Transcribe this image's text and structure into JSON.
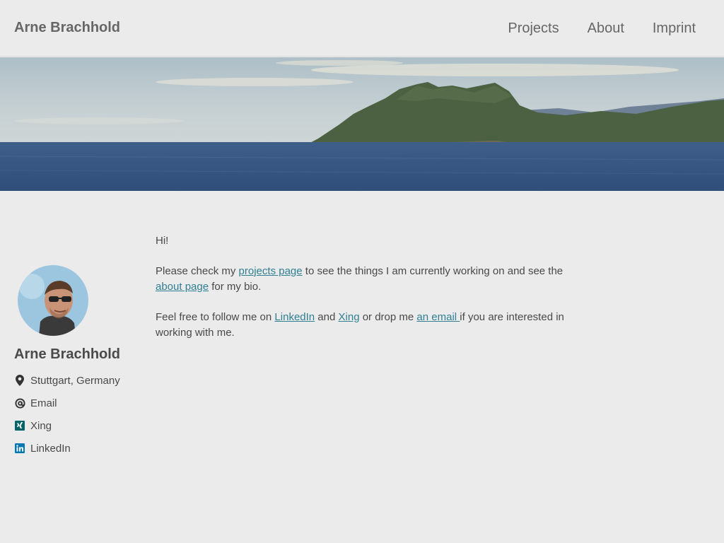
{
  "header": {
    "site_title": "Arne Brachhold",
    "nav": [
      {
        "label": "Projects"
      },
      {
        "label": "About"
      },
      {
        "label": "Imprint"
      }
    ]
  },
  "sidebar": {
    "name": "Arne Brachhold",
    "links": [
      {
        "icon": "map-marker-icon",
        "label": "Stuttgart, Germany"
      },
      {
        "icon": "at-icon",
        "label": "Email"
      },
      {
        "icon": "xing-icon",
        "label": "Xing"
      },
      {
        "icon": "linkedin-icon",
        "label": "LinkedIn"
      }
    ]
  },
  "content": {
    "greeting": "Hi!",
    "p1_before": "Please check my ",
    "p1_link1": "projects page",
    "p1_middle": " to see the things I am currently working on and see the ",
    "p1_link2": "about page",
    "p1_after": " for my bio.",
    "p2_before": "Feel free to follow me on ",
    "p2_link1": "LinkedIn",
    "p2_and": " and ",
    "p2_link2": "Xing",
    "p2_middle": " or drop me ",
    "p2_link3": "an email ",
    "p2_after": "if you are interested in working with me."
  },
  "colors": {
    "background": "#ebebeb",
    "link": "#2f7f93",
    "xing": "#026466",
    "linkedin": "#0077b5"
  }
}
